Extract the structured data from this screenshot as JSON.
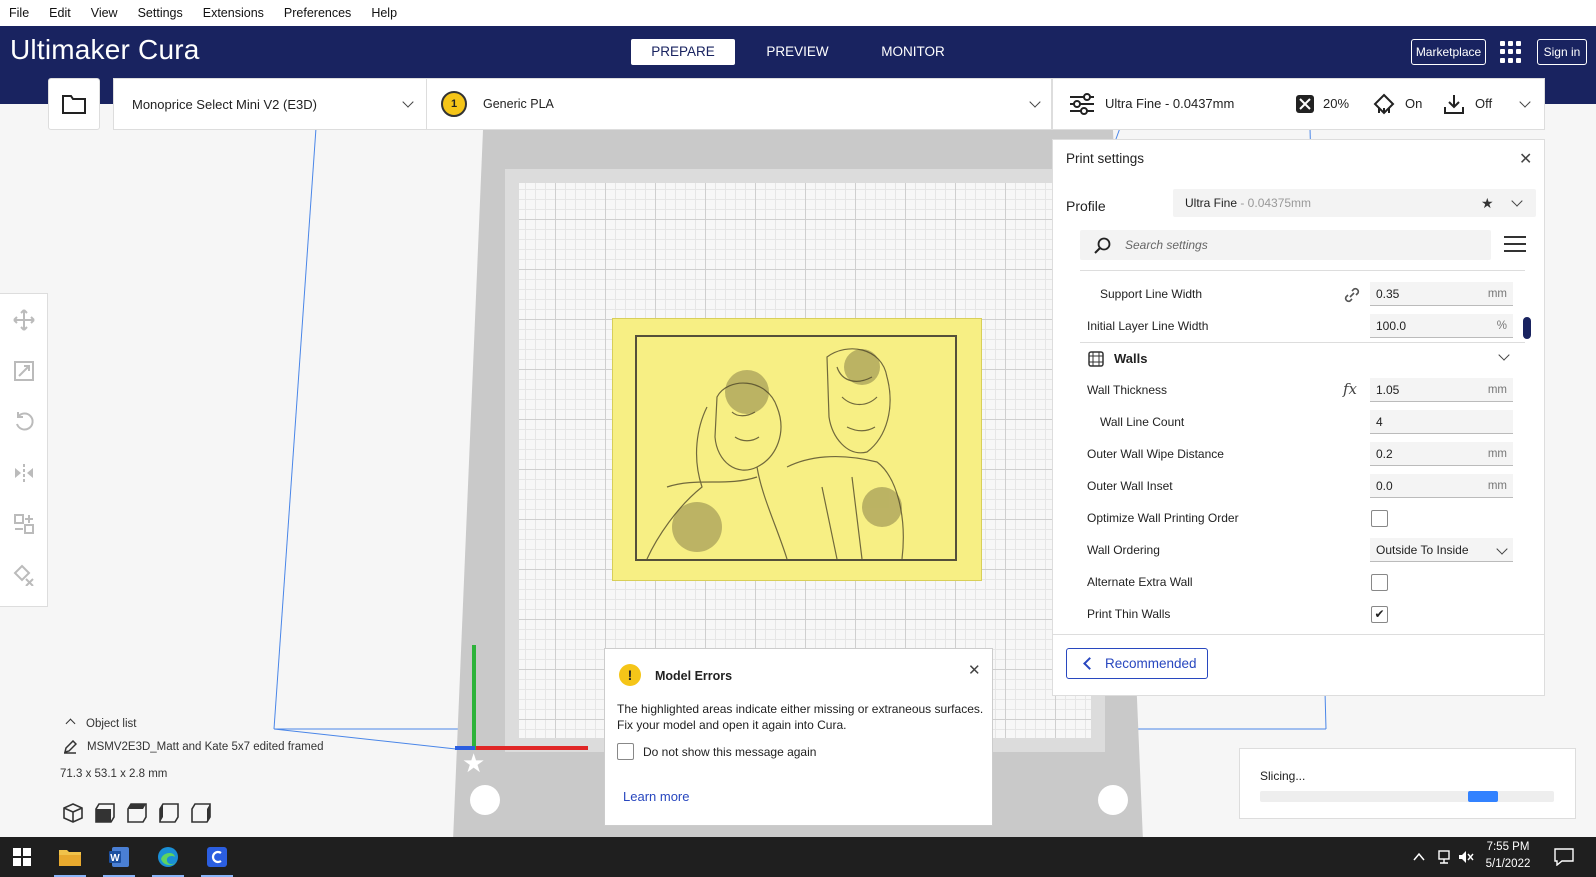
{
  "menu": [
    "File",
    "Edit",
    "View",
    "Settings",
    "Extensions",
    "Preferences",
    "Help"
  ],
  "header": {
    "brand_bold": "Ultimaker",
    "brand_light": " Cura",
    "tabs": [
      "PREPARE",
      "PREVIEW",
      "MONITOR"
    ],
    "active_tab": "PREPARE",
    "marketplace": "Marketplace",
    "sign_in": "Sign in",
    "background_color": "#192360"
  },
  "toolbar": {
    "printer": "Monoprice Select Mini V2 (E3D)",
    "extruder_number": "1",
    "material": "Generic PLA",
    "profile": "Ultra Fine - 0.0437mm",
    "infill": "20%",
    "support": "On",
    "adhesion": "Off",
    "icons": [
      "folder-open-icon",
      "sliders-icon",
      "infill-icon",
      "support-icon",
      "adhesion-icon"
    ]
  },
  "left_tools": [
    "move-icon",
    "scale-icon",
    "rotate-icon",
    "mirror-icon",
    "per-model-settings-icon",
    "support-blocker-icon"
  ],
  "print_settings": {
    "title": "Print settings",
    "profile_label": "Profile",
    "profile_name": "Ultra Fine",
    "profile_detail": " - 0.04375mm",
    "search_placeholder": "Search settings",
    "rows": [
      {
        "label": "Support Line Width",
        "value": "0.35",
        "unit": "mm",
        "indent": true,
        "icon": "link-icon"
      },
      {
        "label": "Initial Layer Line Width",
        "value": "100.0",
        "unit": "%",
        "indent": false
      }
    ],
    "walls_header": "Walls",
    "wall_rows": [
      {
        "label": "Wall Thickness",
        "value": "1.05",
        "unit": "mm",
        "indent": false,
        "icon": "function-icon"
      },
      {
        "label": "Wall Line Count",
        "value": "4",
        "unit": "",
        "indent": true
      },
      {
        "label": "Outer Wall Wipe Distance",
        "value": "0.2",
        "unit": "mm",
        "indent": false
      },
      {
        "label": "Outer Wall Inset",
        "value": "0.0",
        "unit": "mm",
        "indent": false
      }
    ],
    "toggle_rows": [
      {
        "label": "Optimize Wall Printing Order",
        "checked": false
      },
      {
        "label": "Wall Ordering",
        "select": "Outside To Inside"
      },
      {
        "label": "Alternate Extra Wall",
        "checked": false
      },
      {
        "label": "Print Thin Walls",
        "checked": true
      }
    ],
    "recommended_button": "Recommended"
  },
  "object_list": {
    "header": "Object list",
    "object_name": "MSMV2E3D_Matt and Kate 5x7 edited framed",
    "dimensions": "71.3 x 53.1 x 2.8 mm",
    "view_buttons": [
      "3d-view-icon",
      "front-view-icon",
      "top-view-icon",
      "left-view-icon",
      "right-view-icon"
    ]
  },
  "message": {
    "title": "Model Errors",
    "body": "The highlighted areas indicate either missing or extraneous surfaces. Fix your model and open it again into Cura.",
    "checkbox_label": "Do not show this message again",
    "link": "Learn more"
  },
  "slicing": {
    "label": "Slicing...",
    "progress": 0.81
  },
  "taskbar": {
    "apps": [
      "windows-start-icon",
      "file-explorer-icon",
      "word-icon",
      "edge-icon",
      "cura-icon"
    ],
    "time": "7:55 PM",
    "date": "5/1/2022"
  }
}
